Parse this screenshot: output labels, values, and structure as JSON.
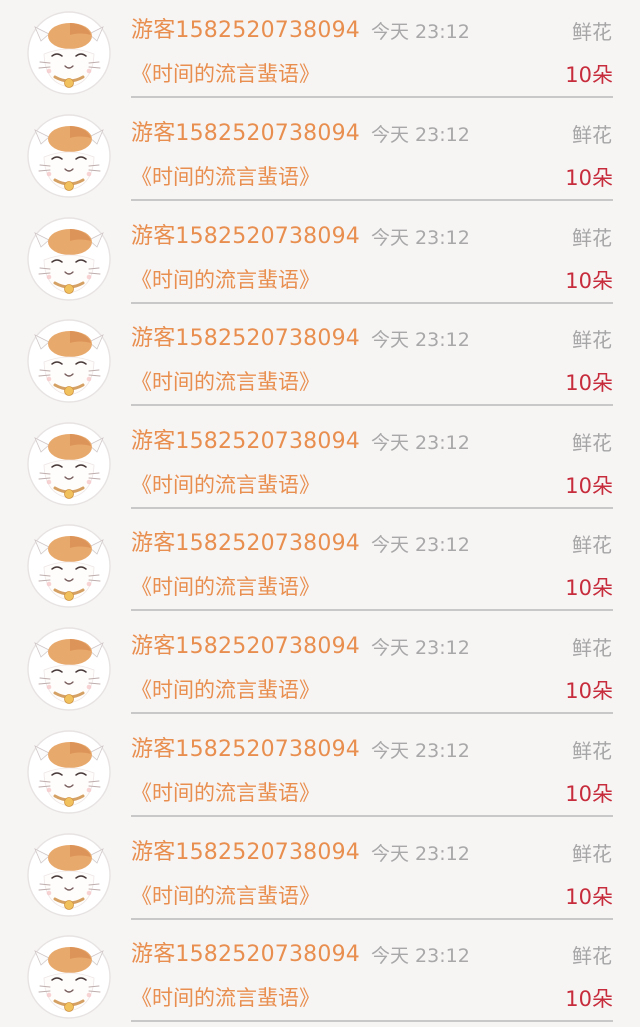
{
  "colors": {
    "background": "#f7f4f4",
    "name_and_title": "#e88f4f",
    "time_and_type": "#a8a8a8",
    "count": "#c62c3b",
    "divider": "#c8c8c8"
  },
  "records": [
    {
      "username": "游客1582520738094",
      "time": "今天  23:12",
      "gift_type": "鲜花",
      "book_title": "《时间的流言蜚语》",
      "count": "10朵",
      "avatar_icon": "cat-avatar-icon"
    },
    {
      "username": "游客1582520738094",
      "time": "今天  23:12",
      "gift_type": "鲜花",
      "book_title": "《时间的流言蜚语》",
      "count": "10朵",
      "avatar_icon": "cat-avatar-icon"
    },
    {
      "username": "游客1582520738094",
      "time": "今天  23:12",
      "gift_type": "鲜花",
      "book_title": "《时间的流言蜚语》",
      "count": "10朵",
      "avatar_icon": "cat-avatar-icon"
    },
    {
      "username": "游客1582520738094",
      "time": "今天  23:12",
      "gift_type": "鲜花",
      "book_title": "《时间的流言蜚语》",
      "count": "10朵",
      "avatar_icon": "cat-avatar-icon"
    },
    {
      "username": "游客1582520738094",
      "time": "今天  23:12",
      "gift_type": "鲜花",
      "book_title": "《时间的流言蜚语》",
      "count": "10朵",
      "avatar_icon": "cat-avatar-icon"
    },
    {
      "username": "游客1582520738094",
      "time": "今天  23:12",
      "gift_type": "鲜花",
      "book_title": "《时间的流言蜚语》",
      "count": "10朵",
      "avatar_icon": "cat-avatar-icon"
    },
    {
      "username": "游客1582520738094",
      "time": "今天  23:12",
      "gift_type": "鲜花",
      "book_title": "《时间的流言蜚语》",
      "count": "10朵",
      "avatar_icon": "cat-avatar-icon"
    },
    {
      "username": "游客1582520738094",
      "time": "今天  23:12",
      "gift_type": "鲜花",
      "book_title": "《时间的流言蜚语》",
      "count": "10朵",
      "avatar_icon": "cat-avatar-icon"
    },
    {
      "username": "游客1582520738094",
      "time": "今天  23:12",
      "gift_type": "鲜花",
      "book_title": "《时间的流言蜚语》",
      "count": "10朵",
      "avatar_icon": "cat-avatar-icon"
    },
    {
      "username": "游客1582520738094",
      "time": "今天  23:12",
      "gift_type": "鲜花",
      "book_title": "《时间的流言蜚语》",
      "count": "10朵",
      "avatar_icon": "cat-avatar-icon"
    }
  ]
}
